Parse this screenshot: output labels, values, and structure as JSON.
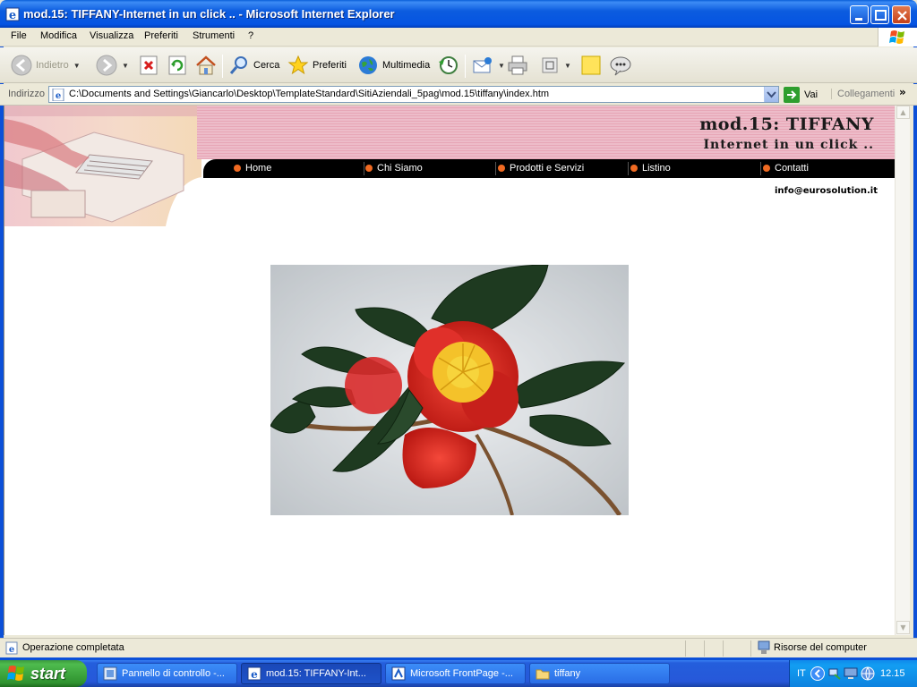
{
  "window": {
    "title": "mod.15: TIFFANY-Internet in un click .. - Microsoft Internet Explorer"
  },
  "menu": [
    "File",
    "Modifica",
    "Visualizza",
    "Preferiti",
    "Strumenti",
    "?"
  ],
  "toolbar": {
    "back": "Indietro",
    "search": "Cerca",
    "favorites": "Preferiti",
    "media": "Multimedia"
  },
  "address": {
    "label": "Indirizzo",
    "url": "C:\\Documents and Settings\\Giancarlo\\Desktop\\TemplateStandard\\SitiAziendali_5pag\\mod.15\\tiffany\\index.htm",
    "go": "Vai",
    "links": "Collegamenti"
  },
  "site": {
    "title": "mod.15: TIFFANY",
    "subtitle": "Internet in un click ..",
    "nav": [
      "Home",
      "Chi Siamo",
      "Prodotti e Servizi",
      "Listino",
      "Contatti"
    ],
    "email": "info@eurosolution.it",
    "accent_color": "#F06A22",
    "band_color": "#E7A6B6"
  },
  "status": {
    "text": "Operazione completata",
    "zone": "Risorse del computer"
  },
  "taskbar": {
    "start": "start",
    "tasks": [
      "Pannello di controllo -...",
      "mod.15: TIFFANY-Int...",
      "Microsoft FrontPage -...",
      "tiffany"
    ],
    "language": "IT",
    "clock": "12.15"
  }
}
